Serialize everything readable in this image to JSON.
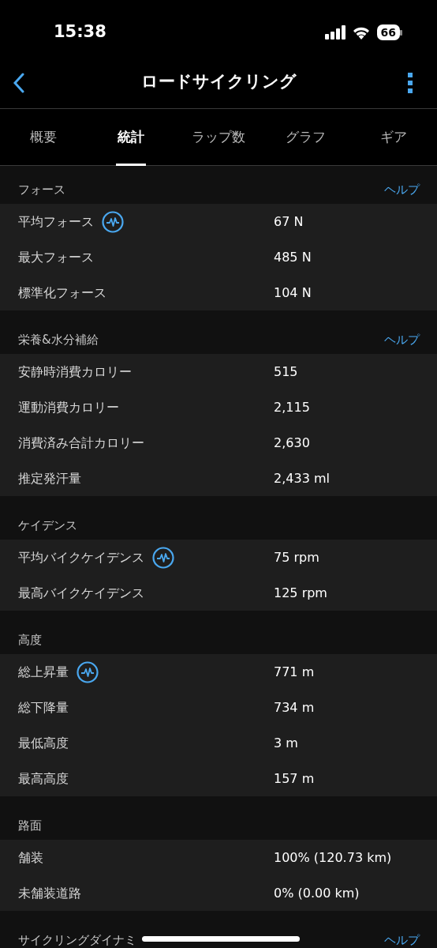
{
  "status_bar": {
    "time": "15:38",
    "battery": "66"
  },
  "nav": {
    "title": "ロードサイクリング"
  },
  "tabs": [
    {
      "label": "概要",
      "selected": false
    },
    {
      "label": "統計",
      "selected": true
    },
    {
      "label": "ラップ数",
      "selected": false
    },
    {
      "label": "グラフ",
      "selected": false
    },
    {
      "label": "ギア",
      "selected": false
    }
  ],
  "sections": [
    {
      "title": "フォース",
      "help": "ヘルプ",
      "rows": [
        {
          "label": "平均フォース",
          "value": "67 N",
          "graph": true
        },
        {
          "label": "最大フォース",
          "value": "485 N",
          "graph": false
        },
        {
          "label": "標準化フォース",
          "value": "104 N",
          "graph": false
        }
      ]
    },
    {
      "title": "栄養&水分補給",
      "help": "ヘルプ",
      "rows": [
        {
          "label": "安静時消費カロリー",
          "value": "515",
          "graph": false
        },
        {
          "label": "運動消費カロリー",
          "value": "2,115",
          "graph": false
        },
        {
          "label": "消費済み合計カロリー",
          "value": "2,630",
          "graph": false
        },
        {
          "label": "推定発汗量",
          "value": "2,433 ml",
          "graph": false
        }
      ]
    },
    {
      "title": "ケイデンス",
      "rows": [
        {
          "label": "平均バイクケイデンス",
          "value": "75 rpm",
          "graph": true
        },
        {
          "label": "最高バイクケイデンス",
          "value": "125 rpm",
          "graph": false
        }
      ]
    },
    {
      "title": "高度",
      "rows": [
        {
          "label": "総上昇量",
          "value": "771 m",
          "graph": true
        },
        {
          "label": "総下降量",
          "value": "734 m",
          "graph": false
        },
        {
          "label": "最低高度",
          "value": "3 m",
          "graph": false
        },
        {
          "label": "最高高度",
          "value": "157 m",
          "graph": false
        }
      ]
    },
    {
      "title": "路面",
      "rows": [
        {
          "label": "舗装",
          "value": "100% (120.73 km)",
          "graph": false
        },
        {
          "label": "未舗装道路",
          "value": "0% (0.00 km)",
          "graph": false
        }
      ]
    },
    {
      "title": "サイクリングダイナミ",
      "help": "ヘルプ"
    }
  ]
}
